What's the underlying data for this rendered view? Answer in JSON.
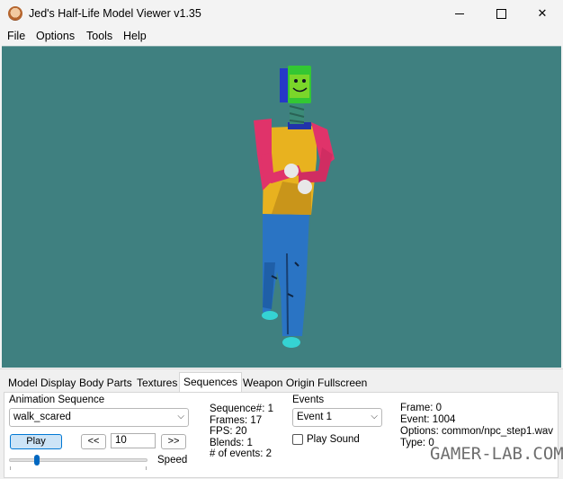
{
  "window": {
    "title": "Jed's Half-Life Model Viewer v1.35",
    "controls": [
      "minimize-icon",
      "maximize-icon",
      "close-icon"
    ]
  },
  "menu": [
    "File",
    "Options",
    "Tools",
    "Help"
  ],
  "viewport": {
    "background": "#3f8080"
  },
  "tabs": [
    {
      "label": "Model Display",
      "active": false
    },
    {
      "label": "Body Parts",
      "active": false
    },
    {
      "label": "Textures",
      "active": false
    },
    {
      "label": "Sequences",
      "active": true
    },
    {
      "label": "Weapon Origin",
      "active": false
    },
    {
      "label": "Fullscreen",
      "active": false
    }
  ],
  "sequences": {
    "animation_label": "Animation Sequence",
    "animation_value": "walk_scared",
    "play_label": "Play",
    "prev_label": "<<",
    "frame_input": "10",
    "next_label": ">>",
    "speed_label": "Speed",
    "speed_level": 0.2,
    "info": [
      "Sequence#: 1",
      "Frames: 17",
      "FPS: 20",
      "Blends: 1",
      "# of events: 2"
    ],
    "events_label": "Events",
    "event_value": "Event 1",
    "play_sound_label": "Play Sound",
    "play_sound_checked": false,
    "event_info": [
      "Frame: 0",
      "Event: 1004",
      "Options: common/npc_step1.wav",
      "Type: 0"
    ]
  },
  "watermark": "GAMER-LAB.COM",
  "colors": {
    "accent": "#0078d4",
    "play_button": "#cce4f7"
  }
}
